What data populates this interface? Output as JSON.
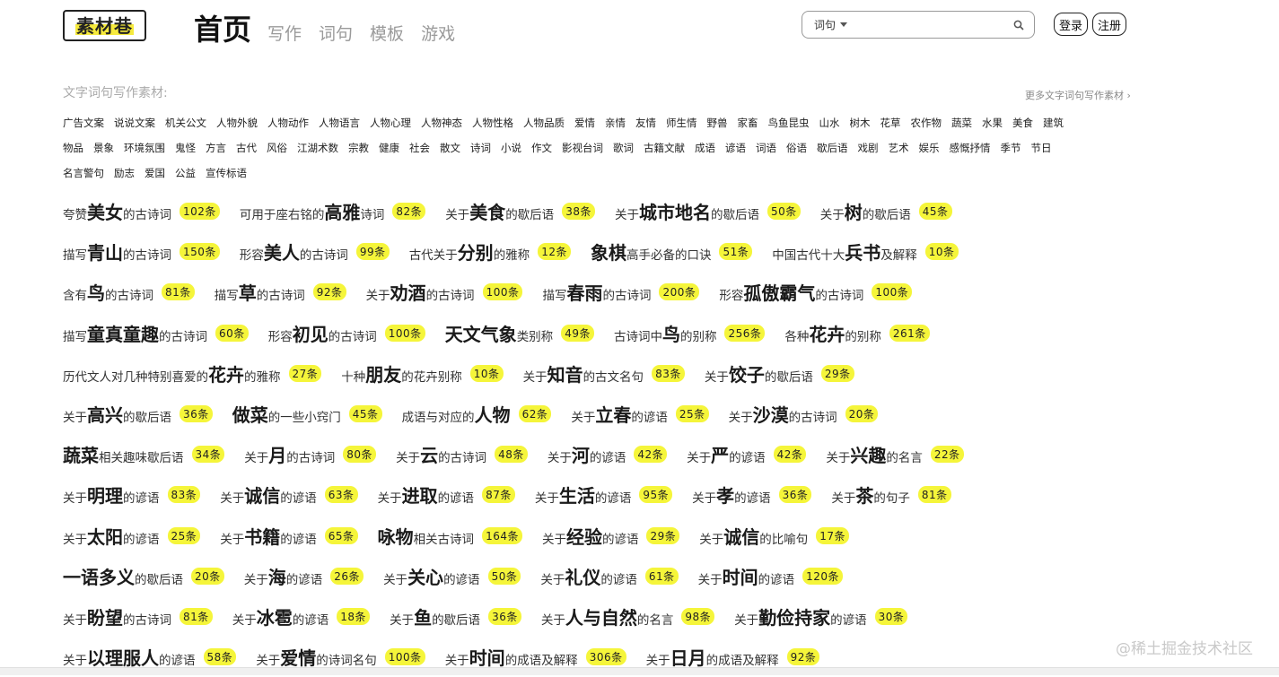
{
  "header": {
    "logo_text": "素材巷",
    "nav": {
      "home": "首页",
      "links": [
        "写作",
        "词句",
        "模板",
        "游戏"
      ]
    },
    "search": {
      "scope": "词句",
      "value": ""
    },
    "login": "登录",
    "register": "注册"
  },
  "materials": {
    "title": "文字词句写作素材:",
    "more": "更多文字词句写作素材 ›",
    "rows": [
      [
        "广告文案",
        "说说文案",
        "机关公文",
        "人物外貌",
        "人物动作",
        "人物语言",
        "人物心理",
        "人物神态",
        "人物性格",
        "人物品质",
        "爱情",
        "亲情",
        "友情",
        "师生情",
        "野兽",
        "家畜",
        "鸟鱼昆虫",
        "山水",
        "树木",
        "花草",
        "农作物",
        "蔬菜",
        "水果",
        "美食",
        "建筑"
      ],
      [
        "物品",
        "景象",
        "环境氛围",
        "鬼怪",
        "方言",
        "古代",
        "风俗",
        "江湖术数",
        "宗教",
        "健康",
        "社会",
        "散文",
        "诗词",
        "小说",
        "作文",
        "影视台词",
        "歌词",
        "古籍文献",
        "成语",
        "谚语",
        "词语",
        "俗语",
        "歇后语",
        "戏剧",
        "艺术",
        "娱乐",
        "感慨抒情",
        "季节",
        "节日"
      ],
      [
        "名言警句",
        "励志",
        "爱国",
        "公益",
        "宣传标语"
      ]
    ]
  },
  "topics": [
    [
      {
        "pre": "夸赞",
        "key": "美女",
        "post": "的古诗词",
        "count": "102条"
      },
      {
        "pre": "可用于座右铭的",
        "key": "高雅",
        "post": "诗词",
        "count": "82条"
      },
      {
        "pre": "关于",
        "key": "美食",
        "post": "的歇后语",
        "count": "38条"
      },
      {
        "pre": "关于",
        "key": "城市地名",
        "post": "的歇后语",
        "count": "50条"
      },
      {
        "pre": "关于",
        "key": "树",
        "post": "的歇后语",
        "count": "45条"
      }
    ],
    [
      {
        "pre": "描写",
        "key": "青山",
        "post": "的古诗词",
        "count": "150条"
      },
      {
        "pre": "形容",
        "key": "美人",
        "post": "的古诗词",
        "count": "99条"
      },
      {
        "pre": "古代关于",
        "key": "分别",
        "post": "的雅称",
        "count": "12条"
      },
      {
        "pre": "",
        "key": "象棋",
        "post": "高手必备的口诀",
        "count": "51条"
      },
      {
        "pre": "中国古代十大",
        "key": "兵书",
        "post": "及解释",
        "count": "10条"
      }
    ],
    [
      {
        "pre": "含有",
        "key": "鸟",
        "post": "的古诗词",
        "count": "81条"
      },
      {
        "pre": "描写",
        "key": "草",
        "post": "的古诗词",
        "count": "92条"
      },
      {
        "pre": "关于",
        "key": "劝酒",
        "post": "的古诗词",
        "count": "100条"
      },
      {
        "pre": "描写",
        "key": "春雨",
        "post": "的古诗词",
        "count": "200条"
      },
      {
        "pre": "形容",
        "key": "孤傲霸气",
        "post": "的古诗词",
        "count": "100条"
      }
    ],
    [
      {
        "pre": "描写",
        "key": "童真童趣",
        "post": "的古诗词",
        "count": "60条"
      },
      {
        "pre": "形容",
        "key": "初见",
        "post": "的古诗词",
        "count": "100条"
      },
      {
        "pre": "",
        "key": "天文气象",
        "post": "类别称",
        "count": "49条"
      },
      {
        "pre": "古诗词中",
        "key": "鸟",
        "post": "的别称",
        "count": "256条"
      },
      {
        "pre": "各种",
        "key": "花卉",
        "post": "的别称",
        "count": "261条"
      }
    ],
    [
      {
        "pre": "历代文人对几种特别喜爱的",
        "key": "花卉",
        "post": "的雅称",
        "count": "27条"
      },
      {
        "pre": "十种",
        "key": "朋友",
        "post": "的花卉别称",
        "count": "10条"
      },
      {
        "pre": "关于",
        "key": "知音",
        "post": "的古文名句",
        "count": "83条"
      },
      {
        "pre": "关于",
        "key": "饺子",
        "post": "的歇后语",
        "count": "29条"
      }
    ],
    [
      {
        "pre": "关于",
        "key": "高兴",
        "post": "的歇后语",
        "count": "36条"
      },
      {
        "pre": "",
        "key": "做菜",
        "post": "的一些小窍门",
        "count": "45条"
      },
      {
        "pre": "成语与对应的",
        "key": "人物",
        "post": "",
        "count": "62条"
      },
      {
        "pre": "关于",
        "key": "立春",
        "post": "的谚语",
        "count": "25条"
      },
      {
        "pre": "关于",
        "key": "沙漠",
        "post": "的古诗词",
        "count": "20条"
      }
    ],
    [
      {
        "pre": "",
        "key": "蔬菜",
        "post": "相关趣味歇后语",
        "count": "34条"
      },
      {
        "pre": "关于",
        "key": "月",
        "post": "的古诗词",
        "count": "80条"
      },
      {
        "pre": "关于",
        "key": "云",
        "post": "的古诗词",
        "count": "48条"
      },
      {
        "pre": "关于",
        "key": "河",
        "post": "的谚语",
        "count": "42条"
      },
      {
        "pre": "关于",
        "key": "严",
        "post": "的谚语",
        "count": "42条"
      },
      {
        "pre": "关于",
        "key": "兴趣",
        "post": "的名言",
        "count": "22条"
      }
    ],
    [
      {
        "pre": "关于",
        "key": "明理",
        "post": "的谚语",
        "count": "83条"
      },
      {
        "pre": "关于",
        "key": "诚信",
        "post": "的谚语",
        "count": "63条"
      },
      {
        "pre": "关于",
        "key": "进取",
        "post": "的谚语",
        "count": "87条"
      },
      {
        "pre": "关于",
        "key": "生活",
        "post": "的谚语",
        "count": "95条"
      },
      {
        "pre": "关于",
        "key": "孝",
        "post": "的谚语",
        "count": "36条"
      },
      {
        "pre": "关于",
        "key": "茶",
        "post": "的句子",
        "count": "81条"
      }
    ],
    [
      {
        "pre": "关于",
        "key": "太阳",
        "post": "的谚语",
        "count": "25条"
      },
      {
        "pre": "关于",
        "key": "书籍",
        "post": "的谚语",
        "count": "65条"
      },
      {
        "pre": "",
        "key": "咏物",
        "post": "相关古诗词",
        "count": "164条"
      },
      {
        "pre": "关于",
        "key": "经验",
        "post": "的谚语",
        "count": "29条"
      },
      {
        "pre": "关于",
        "key": "诚信",
        "post": "的比喻句",
        "count": "17条"
      }
    ],
    [
      {
        "pre": "",
        "key": "一语多义",
        "post": "的歇后语",
        "count": "20条"
      },
      {
        "pre": "关于",
        "key": "海",
        "post": "的谚语",
        "count": "26条"
      },
      {
        "pre": "关于",
        "key": "关心",
        "post": "的谚语",
        "count": "50条"
      },
      {
        "pre": "关于",
        "key": "礼仪",
        "post": "的谚语",
        "count": "61条"
      },
      {
        "pre": "关于",
        "key": "时间",
        "post": "的谚语",
        "count": "120条"
      }
    ],
    [
      {
        "pre": "关于",
        "key": "盼望",
        "post": "的古诗词",
        "count": "81条"
      },
      {
        "pre": "关于",
        "key": "冰雹",
        "post": "的谚语",
        "count": "18条"
      },
      {
        "pre": "关于",
        "key": "鱼",
        "post": "的歇后语",
        "count": "36条"
      },
      {
        "pre": "关于",
        "key": "人与自然",
        "post": "的名言",
        "count": "98条"
      },
      {
        "pre": "关于",
        "key": "勤俭持家",
        "post": "的谚语",
        "count": "30条"
      }
    ],
    [
      {
        "pre": "关于",
        "key": "以理服人",
        "post": "的谚语",
        "count": "58条"
      },
      {
        "pre": "关于",
        "key": "爱情",
        "post": "的诗词名句",
        "count": "100条"
      },
      {
        "pre": "关于",
        "key": "时间",
        "post": "的成语及解释",
        "count": "306条"
      },
      {
        "pre": "关于",
        "key": "日月",
        "post": "的成语及解释",
        "count": "92条"
      }
    ]
  ],
  "watermark": "@稀土掘金技术社区"
}
